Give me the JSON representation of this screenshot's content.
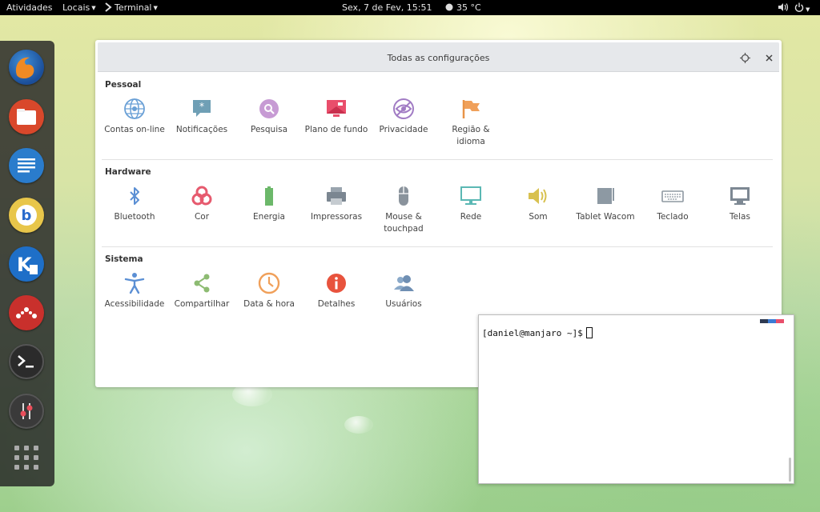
{
  "topbar": {
    "activities": "Atividades",
    "places": "Locais",
    "app_menu": "Terminal",
    "clock": "Sex,  7 de Fev, 15:51",
    "weather": "35 °C"
  },
  "dock": {
    "apps": [
      {
        "name": "firefox-icon",
        "color": "#e66a22"
      },
      {
        "name": "files-icon",
        "color": "#d9482b"
      },
      {
        "name": "writer-icon",
        "color": "#2a7ccc"
      },
      {
        "name": "bitcoin-icon",
        "color": "#e8c64a"
      },
      {
        "name": "kile-icon",
        "color": "#1e6fc8"
      },
      {
        "name": "mendeley-icon",
        "color": "#c9302c"
      },
      {
        "name": "terminal-icon",
        "color": "#333333"
      },
      {
        "name": "mixer-icon",
        "color": "#444444"
      }
    ]
  },
  "settings": {
    "title": "Todas as configurações",
    "sections": {
      "personal": {
        "title": "Pessoal",
        "items": [
          {
            "label": "Contas on-line"
          },
          {
            "label": "Notificações"
          },
          {
            "label": "Pesquisa"
          },
          {
            "label": "Plano de fundo"
          },
          {
            "label": "Privacidade"
          },
          {
            "label": "Região & idioma"
          }
        ]
      },
      "hardware": {
        "title": "Hardware",
        "items": [
          {
            "label": "Bluetooth"
          },
          {
            "label": "Cor"
          },
          {
            "label": "Energia"
          },
          {
            "label": "Impressoras"
          },
          {
            "label": "Mouse & touchpad"
          },
          {
            "label": "Rede"
          },
          {
            "label": "Som"
          },
          {
            "label": "Tablet Wacom"
          },
          {
            "label": "Teclado"
          },
          {
            "label": "Telas"
          }
        ]
      },
      "system": {
        "title": "Sistema",
        "items": [
          {
            "label": "Acessibilidade"
          },
          {
            "label": "Compartilhar"
          },
          {
            "label": "Data & hora"
          },
          {
            "label": "Detalhes"
          },
          {
            "label": "Usuários"
          }
        ]
      }
    }
  },
  "terminal": {
    "prompt": "[daniel@manjaro ~]$"
  }
}
